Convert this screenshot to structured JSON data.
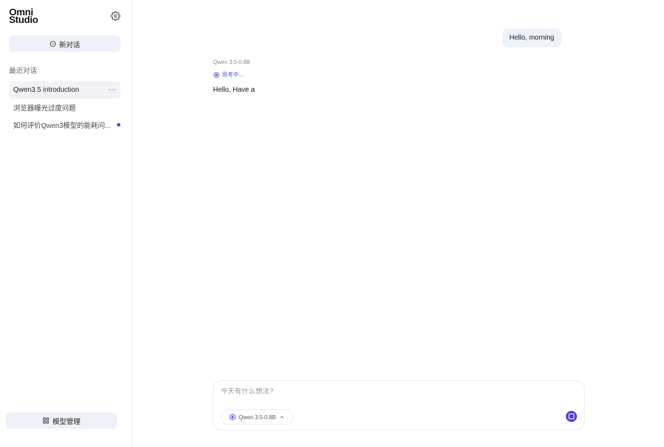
{
  "logo": {
    "line1": "Omni",
    "line2": "Studio"
  },
  "sidebar": {
    "new_chat_label": "新对话",
    "section_title": "最近对话",
    "conversations": [
      {
        "title": "Qwen3.5 introduction",
        "active": true
      },
      {
        "title": "浏览器曝光过度问题"
      },
      {
        "title": "如何评价Qwen3模型的能耗问..."
      }
    ],
    "more_label": "···",
    "model_management_label": "模型管理"
  },
  "chat": {
    "user_message": "Hello, morning",
    "assistant_model": "Qwen 3.5-0.8B",
    "thinking_label": "思考中...",
    "assistant_reply": "Hello, Have a"
  },
  "composer": {
    "placeholder": "今天有什么想法?",
    "value": "",
    "model_selector_label": "Qwen 3.5-0.8B"
  },
  "icons": {
    "settings": "gear-icon",
    "new_chat": "chat-bubble-icon",
    "model_management": "grid-icon",
    "thinking": "sparkle-spinner-icon",
    "model": "qwen-logo-icon",
    "chevron": "chevron-up-icon",
    "stop": "stop-icon"
  },
  "colors": {
    "accent": "#5b3fd6",
    "thinking": "#4a5bd6",
    "button_bg": "#eef1f7",
    "bubble_bg": "#eef2fa"
  }
}
